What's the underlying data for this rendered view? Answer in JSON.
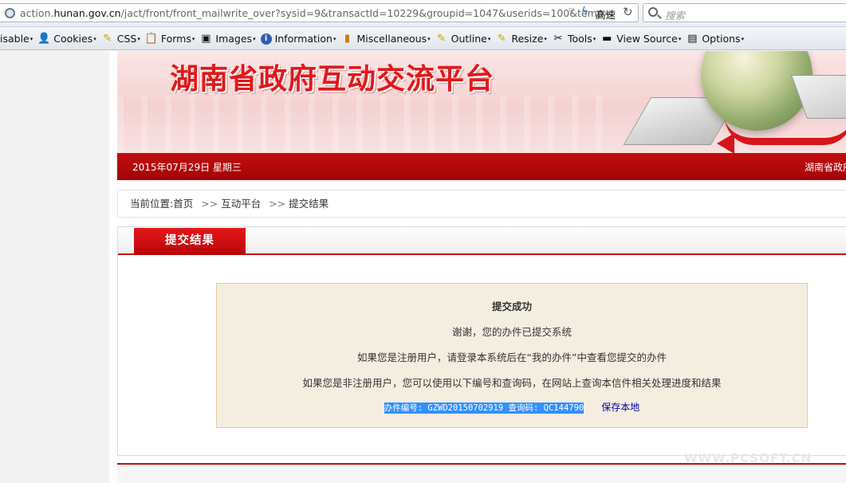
{
  "browser": {
    "url_prefix": "action.",
    "url_domain": "hunan.gov.cn",
    "url_path": "/jact/front/front_mailwrite_over?sysid=9&transactId=10229&groupid=1047&userids=100&temp=",
    "mode_label": "高速",
    "search_placeholder": "搜索"
  },
  "devbar": {
    "items": [
      {
        "label": "isable",
        "icon": "disable-icon"
      },
      {
        "label": "Cookies",
        "icon": "cookie-icon"
      },
      {
        "label": "CSS",
        "icon": "css-icon"
      },
      {
        "label": "Forms",
        "icon": "forms-icon"
      },
      {
        "label": "Images",
        "icon": "images-icon"
      },
      {
        "label": "Information",
        "icon": "info-icon"
      },
      {
        "label": "Miscellaneous",
        "icon": "misc-icon"
      },
      {
        "label": "Outline",
        "icon": "outline-icon"
      },
      {
        "label": "Resize",
        "icon": "resize-icon"
      },
      {
        "label": "Tools",
        "icon": "tools-icon"
      },
      {
        "label": "View Source",
        "icon": "view-source-icon"
      },
      {
        "label": "Options",
        "icon": "options-icon"
      }
    ]
  },
  "site": {
    "banner_title": "湖南省政府互动交流平台",
    "date": "2015年07月29日  星期三",
    "redbar_right": "湖南省政府"
  },
  "breadcrumb": {
    "prefix": "当前位置:",
    "items": [
      "首页",
      "互动平台",
      "提交结果"
    ],
    "separator": ">>"
  },
  "result": {
    "tab_label": "提交结果",
    "title": "提交成功",
    "line1": "谢谢，您的办件已提交系统",
    "line2": "如果您是注册用户，请登录本系统后在“我的办件”中查看您提交的办件",
    "line3": "如果您是非注册用户，您可以使用以下编号和查询码，在网站上查询本信件相关处理进度和结果",
    "code_text": "办件编号: GZWD20150702919 查询码: QC144790",
    "save_label": "保存本地"
  },
  "watermark": "WWW.PCSOFT.CN",
  "colors": {
    "brand_red": "#c40c0e",
    "selection_blue": "#3390ff",
    "msg_bg": "#f4eee1"
  }
}
